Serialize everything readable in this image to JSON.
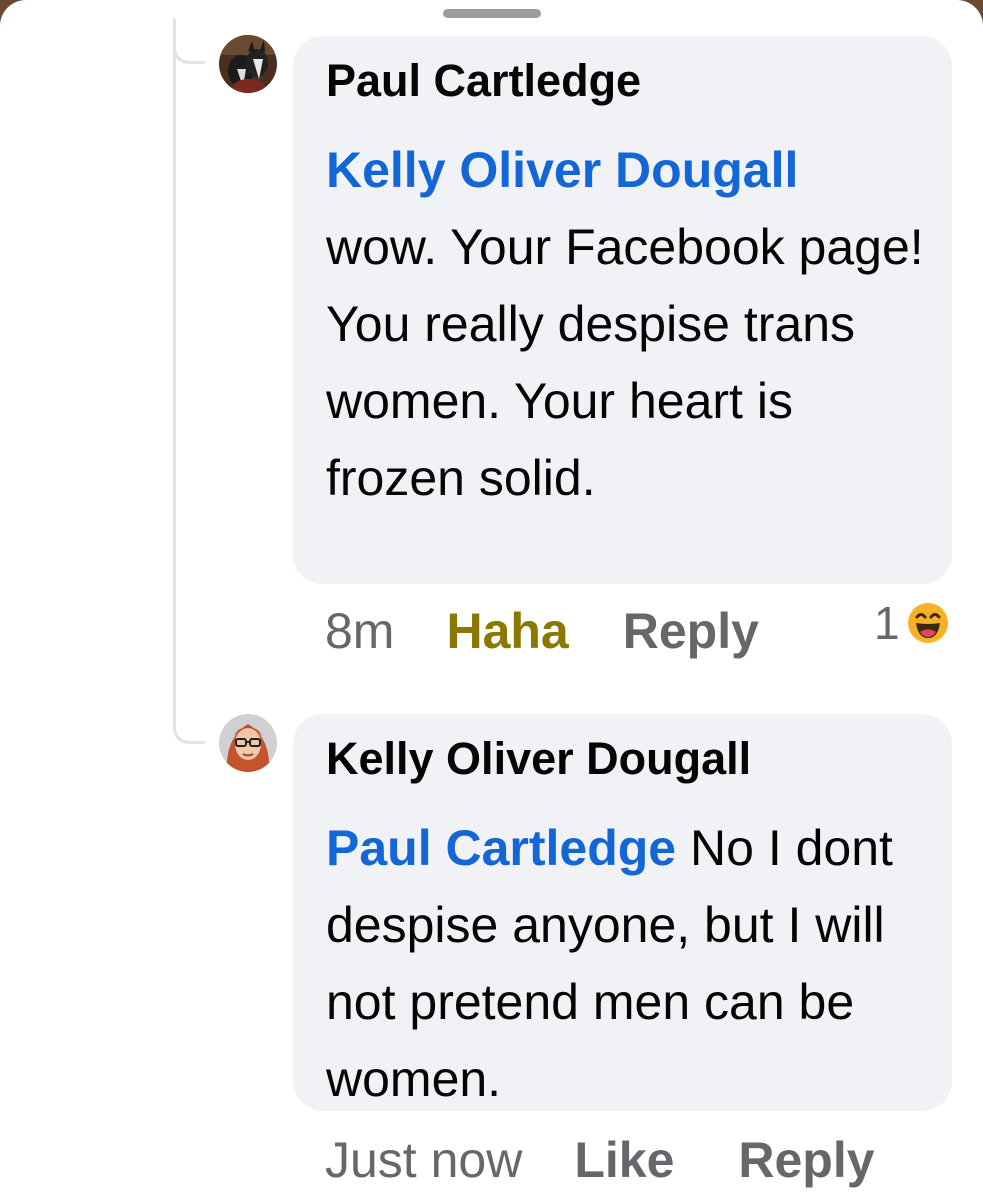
{
  "comments": [
    {
      "author": "Paul Cartledge",
      "mention": "Kelly Oliver Dougall",
      "text": "wow. Your Facebook page! You really despise trans women. Your heart is frozen solid.",
      "time": "8m",
      "reaction_label": "Haha",
      "reply_label": "Reply",
      "reaction_count": "1",
      "reaction_icon": "laughing-emoji-icon",
      "reaction_color": "#f7b125"
    },
    {
      "author": "Kelly Oliver Dougall",
      "mention": "Paul Cartledge",
      "text": "No I dont despise anyone, but I will not pretend men can be women.",
      "time": "Just now",
      "like_label": "Like",
      "reply_label": "Reply"
    }
  ],
  "colors": {
    "mention": "#1366d6",
    "haha_active": "#8a7800",
    "meta_gray": "#65676b",
    "bubble": "#f0f2f5"
  }
}
